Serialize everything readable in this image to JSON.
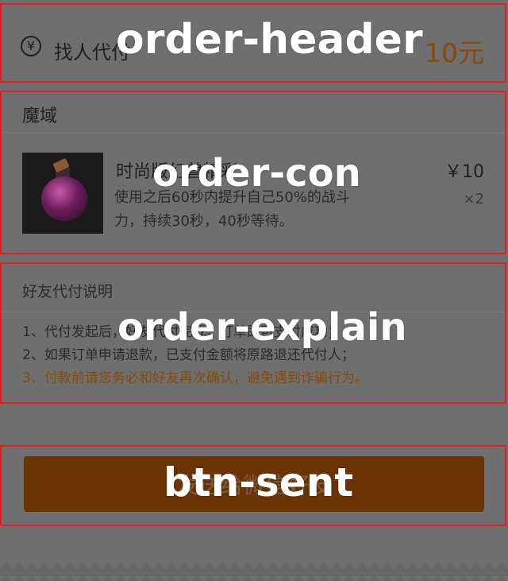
{
  "header": {
    "currency_icon": "yen-circle-icon",
    "title": "找人代付",
    "amount": "10元"
  },
  "order": {
    "shop": "魔域",
    "product": {
      "image_icon": "purple-potion-icon",
      "name": "时尚版幻兽精彩",
      "description": "使用之后60秒内提升自己50%的战斗力，持续30秒，40秒等待。",
      "price": "￥10",
      "quantity": "×2"
    }
  },
  "explain": {
    "title": "好友代付说明",
    "items": [
      "1、代付发起后，好友代付完成，订单即可支付成功；",
      "2、如果订单申请退款，已支付金额将原路退还代付人；",
      "3、付款前请您务必和好友再次确认，避免遇到诈骗行为。"
    ]
  },
  "button": {
    "label": "发送给微信好友"
  },
  "overlay_labels": {
    "header": "order-header",
    "con": "order-con",
    "explain": "order-explain",
    "btn": "btn-sent"
  },
  "colors": {
    "accent": "#8a4a07",
    "button_bg": "#6b3304",
    "outline": "#e21e1e",
    "background": "#6f6f6f"
  }
}
